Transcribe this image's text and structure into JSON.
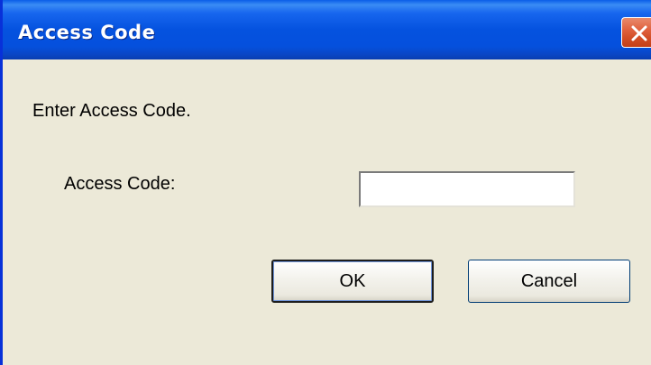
{
  "window": {
    "title": "Access Code",
    "title_color": "#0552df",
    "close_icon": "close-icon"
  },
  "dialog": {
    "prompt": "Enter Access Code.",
    "field_label": "Access Code:",
    "field_value": "",
    "ok_label": "OK",
    "cancel_label": "Cancel"
  },
  "colors": {
    "dialog_background": "#ece9d8",
    "close_button": "#d24d26"
  }
}
